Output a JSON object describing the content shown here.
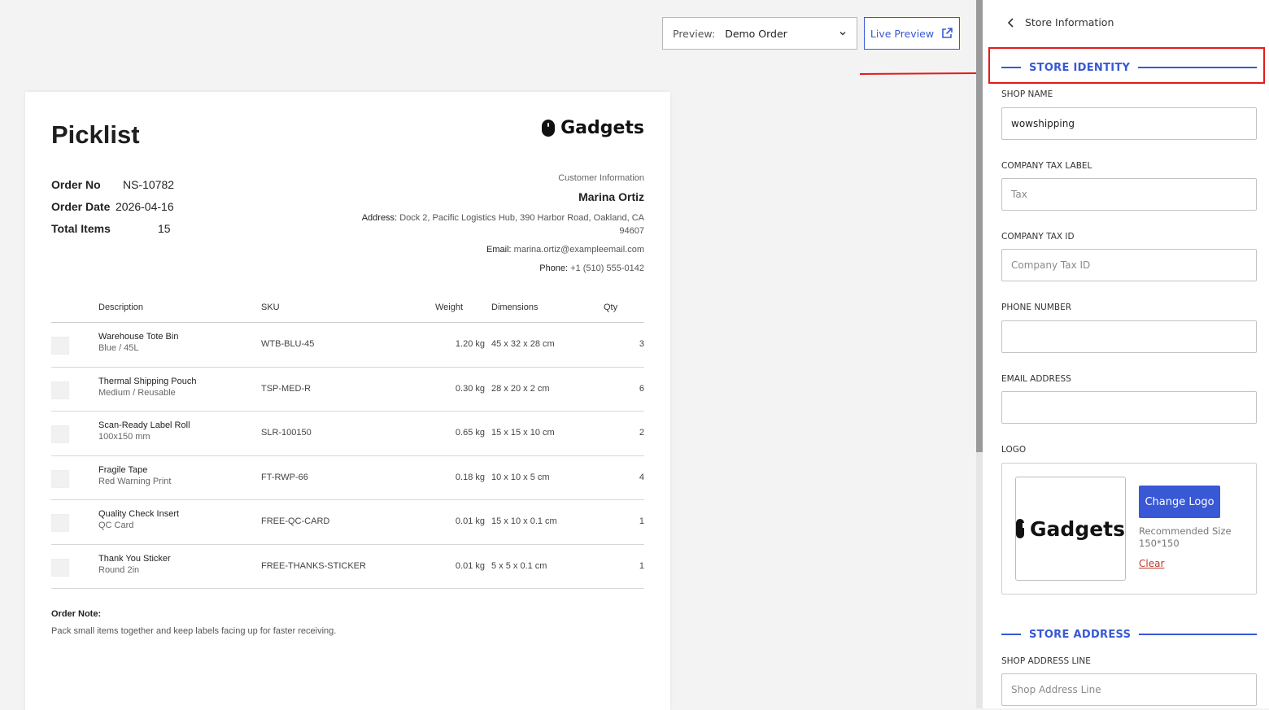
{
  "preview": {
    "label": "Preview:",
    "value": "Demo Order"
  },
  "live_preview": {
    "label": "Live Preview"
  },
  "sheet": {
    "title": "Picklist",
    "brand": "Gadgets",
    "meta": [
      {
        "key": "Order No",
        "value": "NS-10782"
      },
      {
        "key": "Order Date",
        "value": "2026-04-16"
      },
      {
        "key": "Total Items",
        "value": "15"
      }
    ],
    "customer": {
      "header": "Customer Information",
      "name": "Marina Ortiz",
      "address_label": "Address:",
      "address": "Dock 2, Pacific Logistics Hub, 390 Harbor Road, Oakland, CA 94607",
      "email_label": "Email:",
      "email": "marina.ortiz@exampleemail.com",
      "phone_label": "Phone:",
      "phone": "+1 (510) 555-0142"
    },
    "columns": {
      "description": "Description",
      "sku": "SKU",
      "weight": "Weight",
      "dimensions": "Dimensions",
      "qty": "Qty"
    },
    "rows": [
      {
        "name": "Warehouse Tote Bin",
        "variant": "Blue / 45L",
        "sku": "WTB-BLU-45",
        "weight": "1.20 kg",
        "dimensions": "45 x 32 x 28 cm",
        "qty": "3"
      },
      {
        "name": "Thermal Shipping Pouch",
        "variant": "Medium / Reusable",
        "sku": "TSP-MED-R",
        "weight": "0.30 kg",
        "dimensions": "28 x 20 x 2 cm",
        "qty": "6"
      },
      {
        "name": "Scan-Ready Label Roll",
        "variant": "100x150 mm",
        "sku": "SLR-100150",
        "weight": "0.65 kg",
        "dimensions": "15 x 15 x 10 cm",
        "qty": "2"
      },
      {
        "name": "Fragile Tape",
        "variant": "Red Warning Print",
        "sku": "FT-RWP-66",
        "weight": "0.18 kg",
        "dimensions": "10 x 10 x 5 cm",
        "qty": "4"
      },
      {
        "name": "Quality Check Insert",
        "variant": "QC Card",
        "sku": "FREE-QC-CARD",
        "weight": "0.01 kg",
        "dimensions": "15 x 10 x 0.1 cm",
        "qty": "1"
      },
      {
        "name": "Thank You Sticker",
        "variant": "Round 2in",
        "sku": "FREE-THANKS-STICKER",
        "weight": "0.01 kg",
        "dimensions": "5 x 5 x 0.1 cm",
        "qty": "1"
      }
    ],
    "note": {
      "heading": "Order Note:",
      "text": "Pack small items together and keep labels facing up for faster receiving."
    }
  },
  "panel": {
    "back_label": "Store Information",
    "section_identity": "STORE IDENTITY",
    "shop_name": {
      "label": "SHOP NAME",
      "value": "wowshipping"
    },
    "company_tax_label": {
      "label": "COMPANY TAX LABEL",
      "placeholder": "Tax"
    },
    "company_tax_id": {
      "label": "COMPANY TAX ID",
      "placeholder": "Company Tax ID"
    },
    "phone_number": {
      "label": "PHONE NUMBER",
      "value": ""
    },
    "email_address": {
      "label": "EMAIL ADDRESS",
      "value": ""
    },
    "logo": {
      "label": "LOGO",
      "brand": "Gadgets",
      "change_label": "Change Logo",
      "recommended": "Recommended Size 150*150",
      "clear_label": "Clear"
    },
    "section_address": "STORE ADDRESS",
    "shop_address_line": {
      "label": "SHOP ADDRESS LINE",
      "placeholder": "Shop Address Line"
    }
  },
  "colors": {
    "accent": "#3858d6",
    "annotation": "#e31b1b"
  }
}
